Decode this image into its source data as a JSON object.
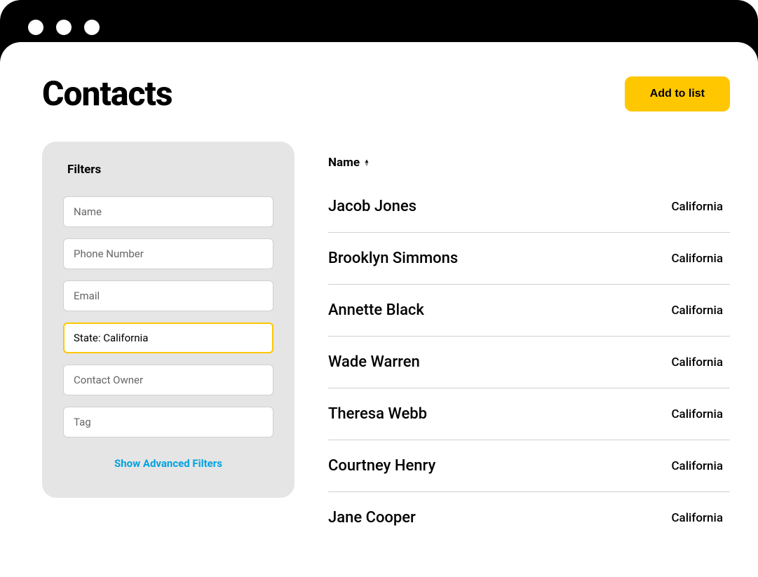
{
  "header": {
    "title": "Contacts",
    "add_button": "Add to list"
  },
  "filters": {
    "panel_title": "Filters",
    "name_placeholder": "Name",
    "phone_placeholder": "Phone Number",
    "email_placeholder": "Email",
    "state_value": "State: California",
    "owner_placeholder": "Contact Owner",
    "tag_placeholder": "Tag",
    "advanced_link": "Show Advanced Filters"
  },
  "table": {
    "column_name": "Name",
    "rows": [
      {
        "name": "Jacob Jones",
        "state": "California"
      },
      {
        "name": "Brooklyn Simmons",
        "state": "California"
      },
      {
        "name": "Annette Black",
        "state": "California"
      },
      {
        "name": "Wade Warren",
        "state": "California"
      },
      {
        "name": "Theresa Webb",
        "state": "California"
      },
      {
        "name": "Courtney Henry",
        "state": "California"
      },
      {
        "name": "Jane Cooper",
        "state": "California"
      }
    ]
  }
}
